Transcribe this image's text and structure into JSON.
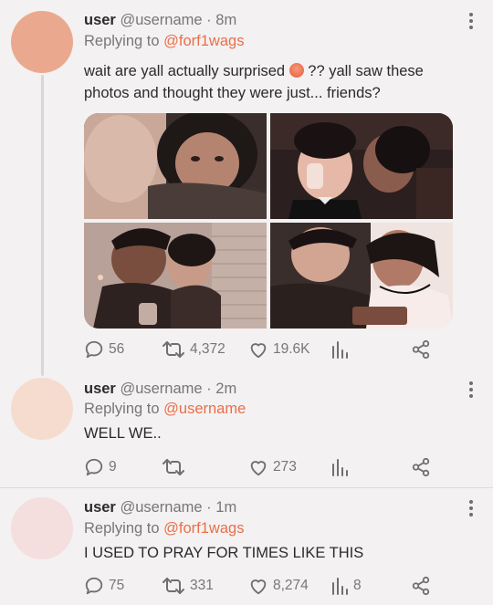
{
  "tweets": [
    {
      "name": "user",
      "handle": "@username",
      "sep": "·",
      "time": "8m",
      "replying_label": "Replying to",
      "replying_to": "@forf1wags",
      "text_before": "wait are yall actually surprised",
      "emoji": "🥵",
      "text_after": "?? yall saw these photos and thought they were just... friends?",
      "avatar_color": "#eaa98f",
      "actions": {
        "replies": "56",
        "retweets": "4,372",
        "likes": "19.6K",
        "views": ""
      }
    },
    {
      "name": "user",
      "handle": "@username",
      "sep": "·",
      "time": "2m",
      "replying_label": "Replying to",
      "replying_to": "@username",
      "text": "WELL WE..",
      "avatar_color": "#f6dccf",
      "actions": {
        "replies": "9",
        "retweets": "",
        "likes": "273",
        "views": ""
      }
    },
    {
      "name": "user",
      "handle": "@username",
      "sep": "·",
      "time": "1m",
      "replying_label": "Replying to",
      "replying_to": "@forf1wags",
      "text": "I USED TO PRAY FOR TIMES LIKE THIS",
      "avatar_color": "#f5dede",
      "actions": {
        "replies": "75",
        "retweets": "331",
        "likes": "8,274",
        "views": "8"
      }
    }
  ],
  "colors": {
    "accent": "#e96f4b",
    "muted": "#777777",
    "background": "#f3f1f1"
  },
  "icons": [
    "reply-icon",
    "retweet-icon",
    "like-icon",
    "views-icon",
    "share-icon",
    "more-icon"
  ]
}
